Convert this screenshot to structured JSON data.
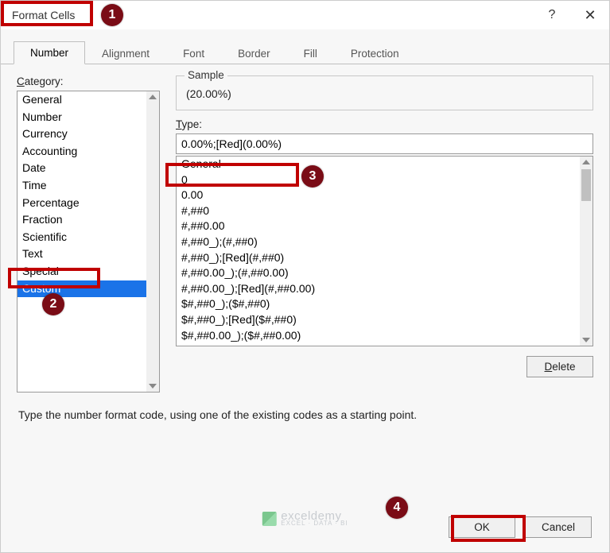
{
  "title": "Format Cells",
  "help_label": "?",
  "close_label": "✕",
  "tabs": [
    "Number",
    "Alignment",
    "Font",
    "Border",
    "Fill",
    "Protection"
  ],
  "active_tab_index": 0,
  "category_label_html": "Category:",
  "categories": [
    "General",
    "Number",
    "Currency",
    "Accounting",
    "Date",
    "Time",
    "Percentage",
    "Fraction",
    "Scientific",
    "Text",
    "Special",
    "Custom"
  ],
  "selected_category_index": 11,
  "sample_label": "Sample",
  "sample_value": "(20.00%)",
  "type_label_html": "Type:",
  "type_value": "0.00%;[Red](0.00%)",
  "type_list": [
    "General",
    "0",
    "0.00",
    "#,##0",
    "#,##0.00",
    "#,##0_);(#,##0)",
    "#,##0_);[Red](#,##0)",
    "#,##0.00_);(#,##0.00)",
    "#,##0.00_);[Red](#,##0.00)",
    "$#,##0_);($#,##0)",
    "$#,##0_);[Red]($#,##0)",
    "$#,##0.00_);($#,##0.00)"
  ],
  "delete_label": "Delete",
  "hint": "Type the number format code, using one of the existing codes as a starting point.",
  "ok_label": "OK",
  "cancel_label": "Cancel",
  "watermark_brand": "exceldemy",
  "watermark_sub": "EXCEL · DATA · BI",
  "badges": {
    "b1": "1",
    "b2": "2",
    "b3": "3",
    "b4": "4"
  }
}
